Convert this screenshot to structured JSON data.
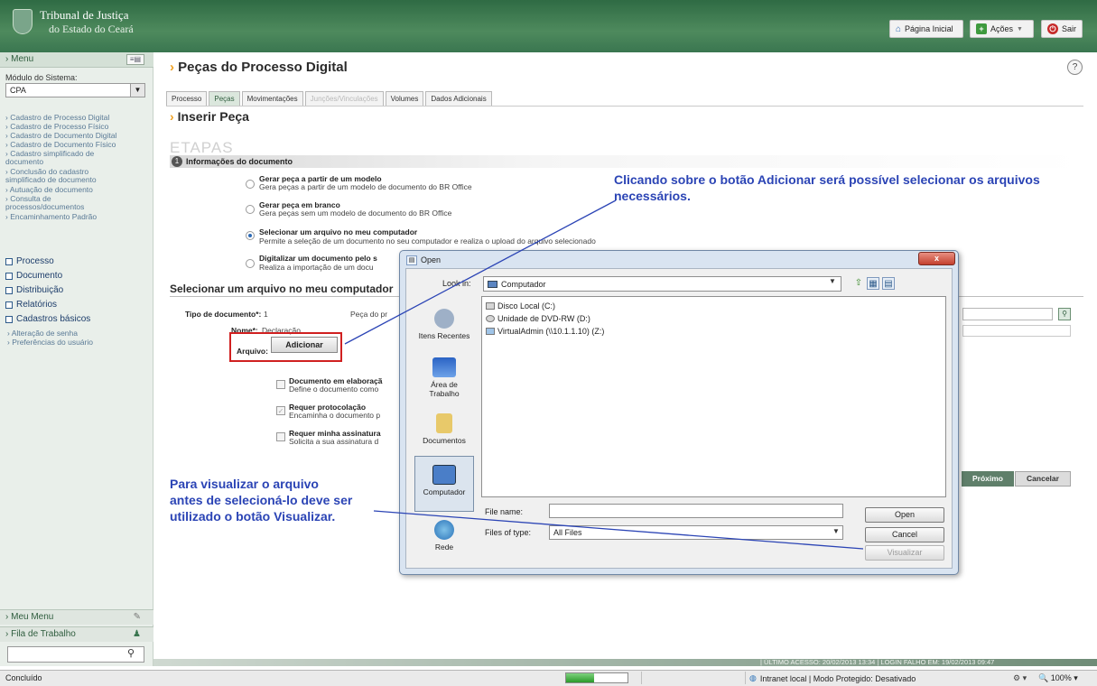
{
  "header": {
    "logo_line1": "Tribunal de Justiça",
    "logo_line2": "do Estado do Ceará",
    "home_label": "Página Inicial",
    "acoes_label": "Ações",
    "sair_label": "Sair"
  },
  "sidebar": {
    "menu_label": "Menu",
    "modulo_label": "Módulo do Sistema:",
    "modulo_value": "CPA",
    "links": [
      "Cadastro de Processo Digital",
      "Cadastro de Processo Físico",
      "Cadastro de Documento Digital",
      "Cadastro de Documento Físico",
      "Cadastro simplificado de documento",
      "Conclusão do cadastro simplificado de documento",
      "Autuação de documento",
      "Consulta de processos/documentos",
      "Encaminhamento Padrão"
    ],
    "sections": [
      "Processo",
      "Documento",
      "Distribuição",
      "Relatórios",
      "Cadastros básicos"
    ],
    "sublinks": [
      "Alteração de senha",
      "Preferências do usuário"
    ],
    "meu_menu": "Meu Menu",
    "fila": "Fila de Trabalho"
  },
  "main": {
    "title": "Peças do Processo Digital",
    "tabs": [
      "Processo",
      "Peças",
      "Movimentações",
      "Junções/Vinculações",
      "Volumes",
      "Dados Adicionais"
    ],
    "subtitle": "Inserir Peça",
    "etapas": "ETAPAS",
    "step_number": "1",
    "step_label": "Informações do documento",
    "options": [
      {
        "title": "Gerar peça a partir de um modelo",
        "desc": "Gera peças a partir de um modelo de documento do BR Office"
      },
      {
        "title": "Gerar peça em branco",
        "desc": "Gera peças sem um modelo de documento do BR Office"
      },
      {
        "title": "Selecionar um arquivo no meu computador",
        "desc": "Permite a seleção de um documento no seu computador e realiza o upload do arquivo selecionado"
      },
      {
        "title": "Digitalizar um documento pelo s",
        "desc": "Realiza a importação de um docu"
      }
    ],
    "section_title": "Selecionar um arquivo no meu computador",
    "tipo_label": "Tipo de documento*:",
    "tipo_value": "1",
    "peca_label": "Peça do pr",
    "nome_label": "Nome*:",
    "nome_value": "Declaração",
    "arquivo_label": "Arquivo:",
    "adicionar_label": "Adicionar",
    "checks": [
      {
        "title": "Documento em elaboraçã",
        "desc": "Define o documento como"
      },
      {
        "title": "Requer protocolação",
        "desc": "Encaminha o documento p"
      },
      {
        "title": "Requer minha assinatura",
        "desc": "Solicita a sua assinatura d"
      }
    ],
    "proximo_label": "Próximo",
    "cancelar_label": "Cancelar"
  },
  "callouts": {
    "top": "Clicando sobre o botão Adicionar será possível selecionar os arquivos necessários.",
    "bottom_line1": "Para visualizar o arquivo",
    "bottom_line2": "antes de selecioná-lo deve ser",
    "bottom_line3": "utilizado o botão Visualizar."
  },
  "dialog": {
    "title": "Open",
    "close_label": "x",
    "lookin_label": "Look in:",
    "lookin_value": "Computador",
    "places": [
      "Itens Recentes",
      "Área de Trabalho",
      "Documentos",
      "Computador",
      "Rede"
    ],
    "drives": [
      "Disco Local (C:)",
      "Unidade de DVD-RW (D:)",
      "VirtualAdmin (\\\\10.1.1.10) (Z:)"
    ],
    "filename_label": "File name:",
    "filetype_label": "Files of type:",
    "filetype_value": "All Files",
    "open_label": "Open",
    "cancel_label": "Cancel",
    "visualizar_label": "Visualizar"
  },
  "status": {
    "app_status": "|  ÚLTIMO ACESSO: 20/02/2013 13:34   |   LOGIN FALHO EM: 19/02/2013 09:47",
    "done": "Concluído",
    "zone": "Intranet local | Modo Protegido: Desativado",
    "zoom": "100%",
    "progress_fraction": 0.45
  },
  "colors": {
    "header_green": "#3a7650",
    "callout_blue": "#2b44b5",
    "highlight_red": "#d02020"
  }
}
